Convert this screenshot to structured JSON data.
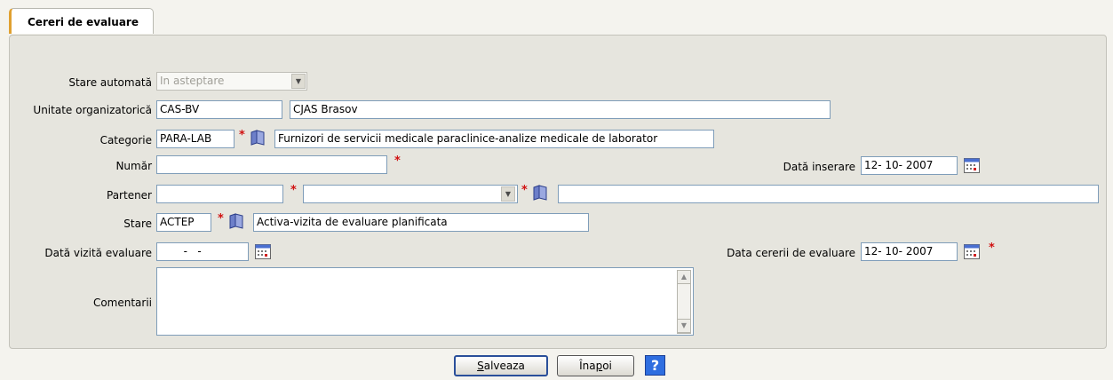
{
  "tab": {
    "title": "Cereri de evaluare"
  },
  "form": {
    "stare_automata": {
      "label": "Stare automată",
      "value": "In asteptare"
    },
    "unitate": {
      "label": "Unitate organizatorică",
      "code": "CAS-BV",
      "name": "CJAS Brasov"
    },
    "categorie": {
      "label": "Categorie",
      "code": "PARA-LAB",
      "name": "Furnizori de servicii medicale paraclinice-analize medicale de laborator"
    },
    "numar": {
      "label": "Număr",
      "value": ""
    },
    "data_inserare": {
      "label": "Dată inserare",
      "value": "12- 10- 2007"
    },
    "partener": {
      "label": "Partener",
      "code": "",
      "select": "",
      "name": ""
    },
    "stare": {
      "label": "Stare",
      "code": "ACTEP",
      "name": "Activa-vizita de evaluare planificata"
    },
    "data_vizita": {
      "label": "Dată vizită evaluare",
      "value": "  -   -"
    },
    "data_cererii": {
      "label": "Data cererii de evaluare",
      "value": "12- 10- 2007"
    },
    "comentarii": {
      "label": "Comentarii",
      "value": ""
    },
    "required_mark": "*"
  },
  "buttons": {
    "save": {
      "prefix": "S",
      "rest": "alveaza"
    },
    "back": {
      "prefix": "Îna",
      "underline": "p",
      "rest": "oi"
    },
    "help": "?"
  },
  "icons": {
    "book": "open-book-icon",
    "calendar": "calendar-icon",
    "dropdown": "chevron-down-icon"
  },
  "colors": {
    "required": "#d01010",
    "panel": "#e6e5de",
    "page": "#f4f3ee",
    "help_button": "#2f6ee0"
  }
}
